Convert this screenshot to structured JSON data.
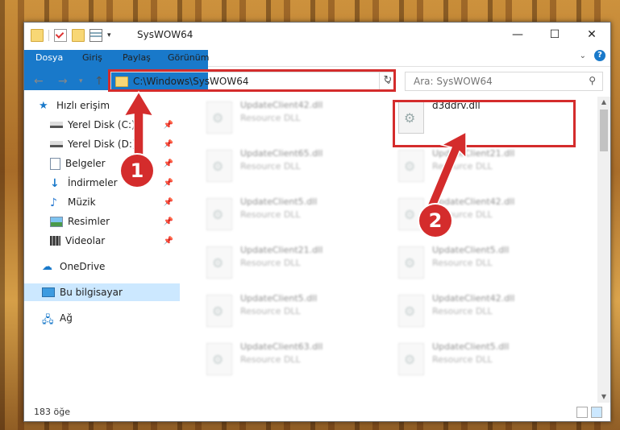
{
  "window": {
    "title": "SysWOW64"
  },
  "controls": {
    "minimize": "—",
    "maximize": "☐",
    "close": "✕"
  },
  "ribbon": {
    "tabs": [
      "Dosya",
      "Giriş",
      "Paylaş",
      "Görünüm"
    ],
    "help": "?"
  },
  "address": {
    "path": "C:\\Windows\\SysWOW64"
  },
  "search": {
    "placeholder": "Ara: SysWOW64"
  },
  "sidebar": {
    "items": [
      {
        "label": "Hızlı erişim",
        "icon": "star-icon"
      },
      {
        "label": "Yerel Disk (C:)",
        "icon": "drive-icon",
        "pinned": true
      },
      {
        "label": "Yerel Disk (D:)",
        "icon": "drive-icon",
        "pinned": true
      },
      {
        "label": "Belgeler",
        "icon": "documents-icon",
        "pinned": true
      },
      {
        "label": "İndirmeler",
        "icon": "downloads-icon",
        "pinned": true
      },
      {
        "label": "Müzik",
        "icon": "music-icon",
        "pinned": true
      },
      {
        "label": "Resimler",
        "icon": "pictures-icon",
        "pinned": true
      },
      {
        "label": "Videolar",
        "icon": "videos-icon",
        "pinned": true
      },
      {
        "label": "OneDrive",
        "icon": "cloud-icon"
      },
      {
        "label": "Bu bilgisayar",
        "icon": "computer-icon",
        "selected": true
      },
      {
        "label": "Ağ",
        "icon": "network-icon"
      }
    ]
  },
  "files": {
    "highlight": {
      "name": "d3ddrv.dll"
    },
    "left": [
      {
        "name": "UpdateClient42.dll",
        "type": "Resource DLL"
      },
      {
        "name": "UpdateClient65.dll",
        "type": "Resource DLL"
      },
      {
        "name": "UpdateClient5.dll",
        "type": "Resource DLL"
      },
      {
        "name": "UpdateClient21.dll",
        "type": "Resource DLL"
      },
      {
        "name": "UpdateClient5.dll",
        "type": "Resource DLL"
      },
      {
        "name": "UpdateClient63.dll",
        "type": "Resource DLL"
      }
    ],
    "right": [
      {
        "name": "UpdateClient21.dll",
        "type": "Resource DLL"
      },
      {
        "name": "UpdateClient42.dll",
        "type": "Resource DLL"
      },
      {
        "name": "UpdateClient5.dll",
        "type": "Resource DLL"
      },
      {
        "name": "UpdateClient42.dll",
        "type": "Resource DLL"
      },
      {
        "name": "UpdateClient5.dll",
        "type": "Resource DLL"
      }
    ]
  },
  "status": {
    "count": "183 öğe"
  },
  "annotations": {
    "marker1": "1",
    "marker2": "2",
    "color": "#d42c2c"
  }
}
